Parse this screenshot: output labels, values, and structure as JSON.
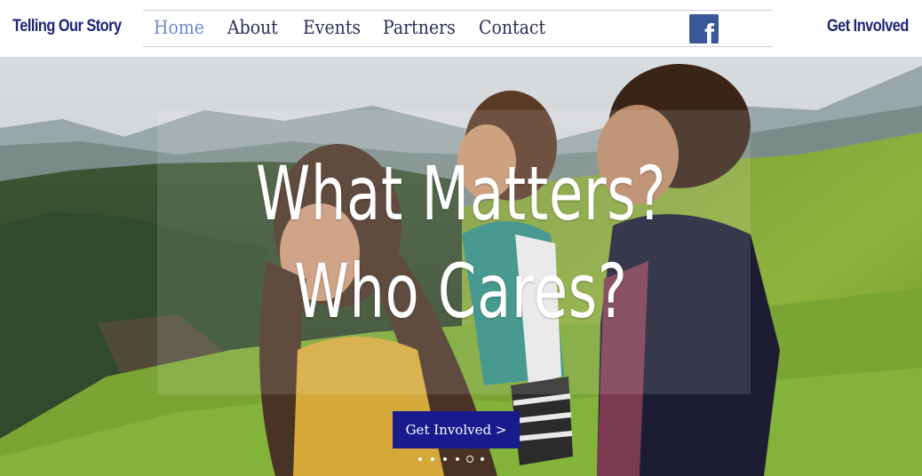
{
  "header": {
    "logo": "Telling Our Story",
    "nav": [
      {
        "label": "Home",
        "active": true
      },
      {
        "label": "About",
        "active": false
      },
      {
        "label": "Events",
        "active": false
      },
      {
        "label": "Partners",
        "active": false
      },
      {
        "label": "Contact",
        "active": false
      }
    ],
    "social_icon": "facebook-icon",
    "social_glyph": "f",
    "cta": "Get Involved"
  },
  "hero": {
    "headline_line1": "What Matters?",
    "headline_line2": "Who Cares?",
    "button_label": "Get Involved >",
    "slides_total": 6,
    "slide_current": 5
  },
  "colors": {
    "brand_navy": "#1f2473",
    "nav_text": "#2c2f57",
    "nav_active": "#6d8bcc",
    "button_bg": "#1a1a8f",
    "facebook_blue": "#3b5998"
  }
}
